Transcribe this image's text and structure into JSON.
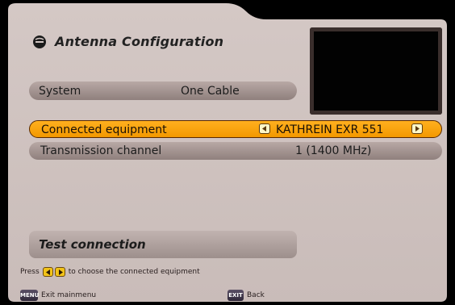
{
  "title": "Antenna Configuration",
  "system": {
    "label": "System",
    "value": "One Cable"
  },
  "rows": [
    {
      "label": "Connected equipment",
      "value": "KATHREIN EXR 551"
    },
    {
      "label": "Transmission channel",
      "value": "1 (1400 MHz)"
    }
  ],
  "test_button": "Test connection",
  "hint": {
    "prefix": "Press",
    "suffix": "to choose the connected equipment"
  },
  "footer": {
    "menu_key": "MENU",
    "menu_label": "Exit mainmenu",
    "exit_key": "EXIT",
    "exit_label": "Back"
  },
  "colors": {
    "panel": "#cfc2bf",
    "highlight": "#f7a21b",
    "row": "#a89896"
  }
}
